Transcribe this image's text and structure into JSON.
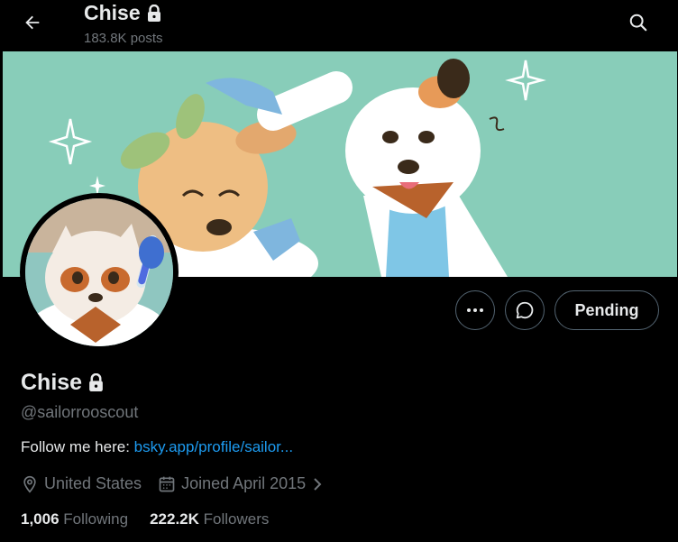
{
  "header": {
    "title": "Chise",
    "posts_count": "183.8K posts"
  },
  "actions": {
    "more_label": "More",
    "message_label": "Message",
    "pending_label": "Pending"
  },
  "profile": {
    "display_name": "Chise",
    "handle": "@sailorrooscout",
    "bio_prefix": "Follow me here: ",
    "bio_link": "bsky.app/profile/sailor...",
    "location": "United States",
    "joined": "Joined April 2015",
    "following_count": "1,006",
    "following_label": "Following",
    "followers_count": "222.2K",
    "followers_label": "Followers"
  },
  "colors": {
    "background": "#000000",
    "text_primary": "#e7e9ea",
    "text_secondary": "#71767b",
    "link": "#1d9bf0",
    "border": "#536471",
    "banner_bg": "#88cdb9"
  },
  "icons": {
    "back": "arrow-left-icon",
    "search": "search-icon",
    "lock": "lock-icon",
    "more": "ellipsis-icon",
    "message": "chat-bubble-icon",
    "location": "location-pin-icon",
    "calendar": "calendar-icon",
    "chevron": "chevron-right-icon"
  }
}
